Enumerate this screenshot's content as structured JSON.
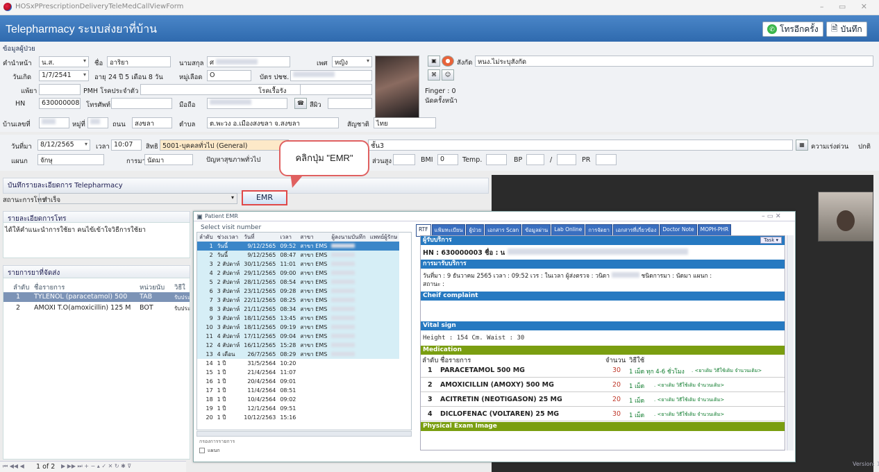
{
  "window": {
    "title": "HOSxPPrescriptionDeliveryTeleMedCallViewForm",
    "controls": "–  ▭  ✕"
  },
  "header": {
    "title": "Telepharmacy ระบบส่งยาที่บ้าน",
    "call_again_label": "โทรอีกครั้ง",
    "save_label": "บันทึก"
  },
  "patient": {
    "section_label": "ข้อมูลผู้ป่วย",
    "prefix_label": "คำนำหน้า",
    "prefix_value": "น.ส.",
    "fname_label": "ชื่อ",
    "fname_value": "อาริยา",
    "lname_label": "นามสกุล",
    "lname_value": "ศ",
    "sex_label": "เพศ",
    "sex_value": "หญิง",
    "dob_label": "วันเกิด",
    "dob_value": "1/7/2541",
    "age_label": "อายุ",
    "age_value": "24 ปี 5 เดือน 8 วัน",
    "blood_label": "หมู่เลือด",
    "blood_value": "O",
    "cid_label": "บัตร ปชช.",
    "allergy_label": "แพ้ยา",
    "pmh_label": "PMH โรคประจำตัว",
    "chronic_label": "โรคเรื้อรัง",
    "hn_label": "HN",
    "hn_value": "630000008",
    "phone_label": "โทรศัพท์",
    "mobile_label": "มือถือ",
    "skin_label": "สีผิว",
    "house_label": "บ้านเลขที่",
    "moo_label": "หมู่ที่",
    "road_label": "ถนน",
    "road_value": "สงขลา",
    "tambon_label": "ตำบล",
    "tambon_value": "ต.พะวง อ.เมืองสงขลา จ.สงขลา",
    "nation_label": "สัญชาติ",
    "nation_value": "ไทย",
    "affil_label": "สังกัด",
    "affil_value": "หนง.ไม่ระบุสังกัด",
    "finger_label": "Finger : 0",
    "appt_label": "นัดครั้งหน้า"
  },
  "visit": {
    "date_label": "วันที่มา",
    "date_value": "8/12/2565",
    "time_label": "เวลา",
    "time_value": "10:07",
    "right_label": "สิทธิ",
    "right_value": "5001-บุคคลทั่วไป (General)",
    "right_extra": "ชั้น3",
    "urgency_label": "ความเร่งด่วน",
    "urgency_value": "ปกติ",
    "dept_label": "แผนก",
    "dept_value": "จักษุ",
    "visit_type_label": "การมา",
    "visit_type_value": "นัดมา",
    "problem_label": "ปัญหาสุขภาพทั่วไป",
    "height_label": "ส่วนสูง",
    "bmi_label": "BMI",
    "bmi_value": "0",
    "temp_label": "Temp.",
    "bp_label": "BP",
    "bp_sep": "/",
    "pr_label": "PR"
  },
  "callout": {
    "text": "คลิกปุ่ม \"EMR\""
  },
  "tele": {
    "section_label": "บันทึกรายละเอียดการ Telepharmacy",
    "status_label": "สถานะการโทร",
    "status_value": "สำเร็จ",
    "emr_button": "EMR",
    "detail_label": "รายละเอียดการโทร",
    "detail_text": "ได้ให้คำแนะนำการใช้ยา คนไข้เข้าใจวิธีการใช้ยา",
    "drug_list_label": "รายการยาที่จัดส่ง",
    "drug_cols": [
      "ลำดับ",
      "ชื่อรายการ",
      "หน่วยนับ",
      "วิธีใ"
    ],
    "drugs": [
      {
        "no": "1",
        "name": "TYLENOL (paracetamol) 500",
        "unit": "TAB",
        "use": "รับประ"
      },
      {
        "no": "2",
        "name": "AMOXI T.O(amoxicillin) 125 M",
        "unit": "BOT",
        "use": "รับประ"
      }
    ],
    "pager": "1 of 2"
  },
  "emr": {
    "title": "Patient EMR",
    "select_visit_label": "Select visit number",
    "visit_cols": [
      "ลำดับ",
      "ช่วงเวลา",
      "วันที่",
      "เวลา",
      "สาขา",
      "ผู้ลงนามบันทึก",
      "แพทย์ผู้รักษ"
    ],
    "visits": [
      {
        "no": "1",
        "span": "วันนี้",
        "date": "9/12/2565",
        "time": "09:52",
        "branch": "สาขา EMS"
      },
      {
        "no": "2",
        "span": "วันนี้",
        "date": "9/12/2565",
        "time": "08:47",
        "branch": "สาขา EMS"
      },
      {
        "no": "3",
        "span": "2 สัปดาห์",
        "date": "30/11/2565",
        "time": "11:01",
        "branch": "สาขา EMS"
      },
      {
        "no": "4",
        "span": "2 สัปดาห์",
        "date": "29/11/2565",
        "time": "09:00",
        "branch": "สาขา EMS"
      },
      {
        "no": "5",
        "span": "2 สัปดาห์",
        "date": "28/11/2565",
        "time": "08:54",
        "branch": "สาขา EMS"
      },
      {
        "no": "6",
        "span": "3 สัปดาห์",
        "date": "23/11/2565",
        "time": "09:28",
        "branch": "สาขา EMS"
      },
      {
        "no": "7",
        "span": "3 สัปดาห์",
        "date": "22/11/2565",
        "time": "08:25",
        "branch": "สาขา EMS"
      },
      {
        "no": "8",
        "span": "3 สัปดาห์",
        "date": "21/11/2565",
        "time": "08:34",
        "branch": "สาขา EMS"
      },
      {
        "no": "9",
        "span": "3 สัปดาห์",
        "date": "18/11/2565",
        "time": "13:45",
        "branch": "สาขา EMS"
      },
      {
        "no": "10",
        "span": "3 สัปดาห์",
        "date": "18/11/2565",
        "time": "09:19",
        "branch": "สาขา EMS"
      },
      {
        "no": "11",
        "span": "4 สัปดาห์",
        "date": "17/11/2565",
        "time": "09:04",
        "branch": "สาขา EMS"
      },
      {
        "no": "12",
        "span": "4 สัปดาห์",
        "date": "16/11/2565",
        "time": "15:28",
        "branch": "สาขา EMS"
      },
      {
        "no": "13",
        "span": "4 เดือน",
        "date": "26/7/2565",
        "time": "08:29",
        "branch": "สาขา EMS"
      },
      {
        "no": "14",
        "span": "1 ปี",
        "date": "31/5/2564",
        "time": "10:20",
        "branch": ""
      },
      {
        "no": "15",
        "span": "1 ปี",
        "date": "21/4/2564",
        "time": "11:07",
        "branch": ""
      },
      {
        "no": "16",
        "span": "1 ปี",
        "date": "20/4/2564",
        "time": "09:01",
        "branch": ""
      },
      {
        "no": "17",
        "span": "1 ปี",
        "date": "11/4/2564",
        "time": "08:51",
        "branch": ""
      },
      {
        "no": "18",
        "span": "1 ปี",
        "date": "10/4/2564",
        "time": "09:02",
        "branch": ""
      },
      {
        "no": "19",
        "span": "1 ปี",
        "date": "12/1/2564",
        "time": "09:51",
        "branch": ""
      },
      {
        "no": "20",
        "span": "1 ปี",
        "date": "10/12/2563",
        "time": "15:16",
        "branch": ""
      }
    ],
    "filter_label": "กรองการรายการ",
    "filter_check": "แผนก",
    "tabs": [
      "RTF",
      "แฟ้มทะเบียน",
      "ผู้ป่วย",
      "เอกสาร Scan",
      "ข้อมูลผ่าน",
      "Lab Online",
      "การจัดยา",
      "เอกสารที่เกี่ยวข้อง",
      "Doctor Note",
      "MOPH-PHR"
    ],
    "task_label": "Task ▾",
    "service_head": "ผู้รับบริการ",
    "hn_line": "HN : 630000003 ชื่อ : น",
    "visit_head": "การมารับบริการ",
    "visit_line": "วันที่มา : 9 ธันวาคม 2565 เวลา : 09:52 เวร : ในเวลา ผู้ส่งตรวจ : วนิดา",
    "visit_type": "ชนิดการมา : นัดมา แผนก :",
    "status_line": "สถานะ :",
    "cc_head": "Cheif complaint",
    "vital_head": "Vital sign",
    "vital_line": "Height : 154 Cm. Waist : 30",
    "med_head": "Medication",
    "med_cols": [
      "ลำดับ",
      "ชื่อรายการ",
      "จำนวน",
      "วิธีใช้"
    ],
    "meds": [
      {
        "no": "1",
        "name": "PARACETAMOL 500 MG",
        "qty": "30",
        "use": "1 เม็ด ทุก 4-6 ชั่วโมง",
        "note": ". <ยาเดิม วิธีใช้เดิม จำนวนเดิม>"
      },
      {
        "no": "2",
        "name": "AMOXICILLIN (AMOXY) 500 MG",
        "qty": "20",
        "use": "1 เม็ด",
        "note": ". <ยาเดิม วิธีใช้เดิม จำนวนเดิม>"
      },
      {
        "no": "3",
        "name": "ACITRETIN (NEOTIGASON) 25 MG",
        "qty": "20",
        "use": "1 เม็ด",
        "note": ". <ยาเดิม วิธีใช้เดิม จำนวนเดิม>"
      },
      {
        "no": "4",
        "name": "DICLOFENAC (VOLTAREN) 25 MG",
        "qty": "30",
        "use": "1 เม็ด",
        "note": ". <ยาเดิม วิธีใช้เดิม จำนวนเดิม>"
      }
    ],
    "pe_head": "Physical Exam Image"
  },
  "version_label": "Version: 141"
}
